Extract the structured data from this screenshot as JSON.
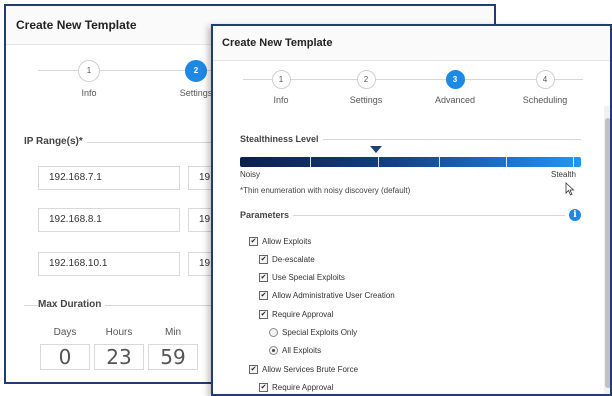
{
  "back_window": {
    "title": "Create New Template",
    "steps": [
      {
        "num": "1",
        "label": "Info",
        "active": false
      },
      {
        "num": "2",
        "label": "Settings",
        "active": true
      }
    ],
    "ip_section_label": "IP Range(s)*",
    "ip_rows": [
      {
        "start": "192.168.7.1",
        "end": "19"
      },
      {
        "start": "192.168.8.1",
        "end": "19"
      },
      {
        "start": "192.168.10.1",
        "end": "19"
      }
    ],
    "duration_label": "Max Duration",
    "duration": {
      "days_label": "Days",
      "days": "0",
      "hours_label": "Hours",
      "hours": "23",
      "min_label": "Min",
      "min": "59"
    }
  },
  "front_window": {
    "title": "Create New Template",
    "steps": [
      {
        "num": "1",
        "label": "Info",
        "active": false
      },
      {
        "num": "2",
        "label": "Settings",
        "active": false
      },
      {
        "num": "3",
        "label": "Advanced",
        "active": true
      },
      {
        "num": "4",
        "label": "Scheduling",
        "active": false
      }
    ],
    "stealth": {
      "label": "Stealthiness Level",
      "min_label": "Noisy",
      "max_label": "Stealth",
      "level_fraction": 0.4,
      "note": "*Thin enumeration with noisy discovery (default)"
    },
    "parameters_label": "Parameters",
    "parameters": [
      {
        "kind": "checkbox",
        "checked": true,
        "label": "Allow Exploits"
      },
      {
        "kind": "checkbox",
        "checked": true,
        "label": "De-escalate"
      },
      {
        "kind": "checkbox",
        "checked": true,
        "label": "Use Special Exploits"
      },
      {
        "kind": "checkbox",
        "checked": true,
        "label": "Allow Administrative User Creation"
      },
      {
        "kind": "checkbox",
        "checked": true,
        "label": "Require Approval"
      },
      {
        "kind": "radio",
        "checked": false,
        "label": "Special Exploits Only"
      },
      {
        "kind": "radio",
        "checked": true,
        "label": "All Exploits"
      },
      {
        "kind": "checkbox",
        "checked": true,
        "label": "Allow Services Brute Force"
      },
      {
        "kind": "checkbox",
        "checked": true,
        "label": "Require Approval"
      }
    ]
  },
  "colors": {
    "accent": "#1e88e5",
    "window_border": "#1f3d6e",
    "slider_start": "#0b1f4a",
    "slider_end": "#2196f3"
  }
}
